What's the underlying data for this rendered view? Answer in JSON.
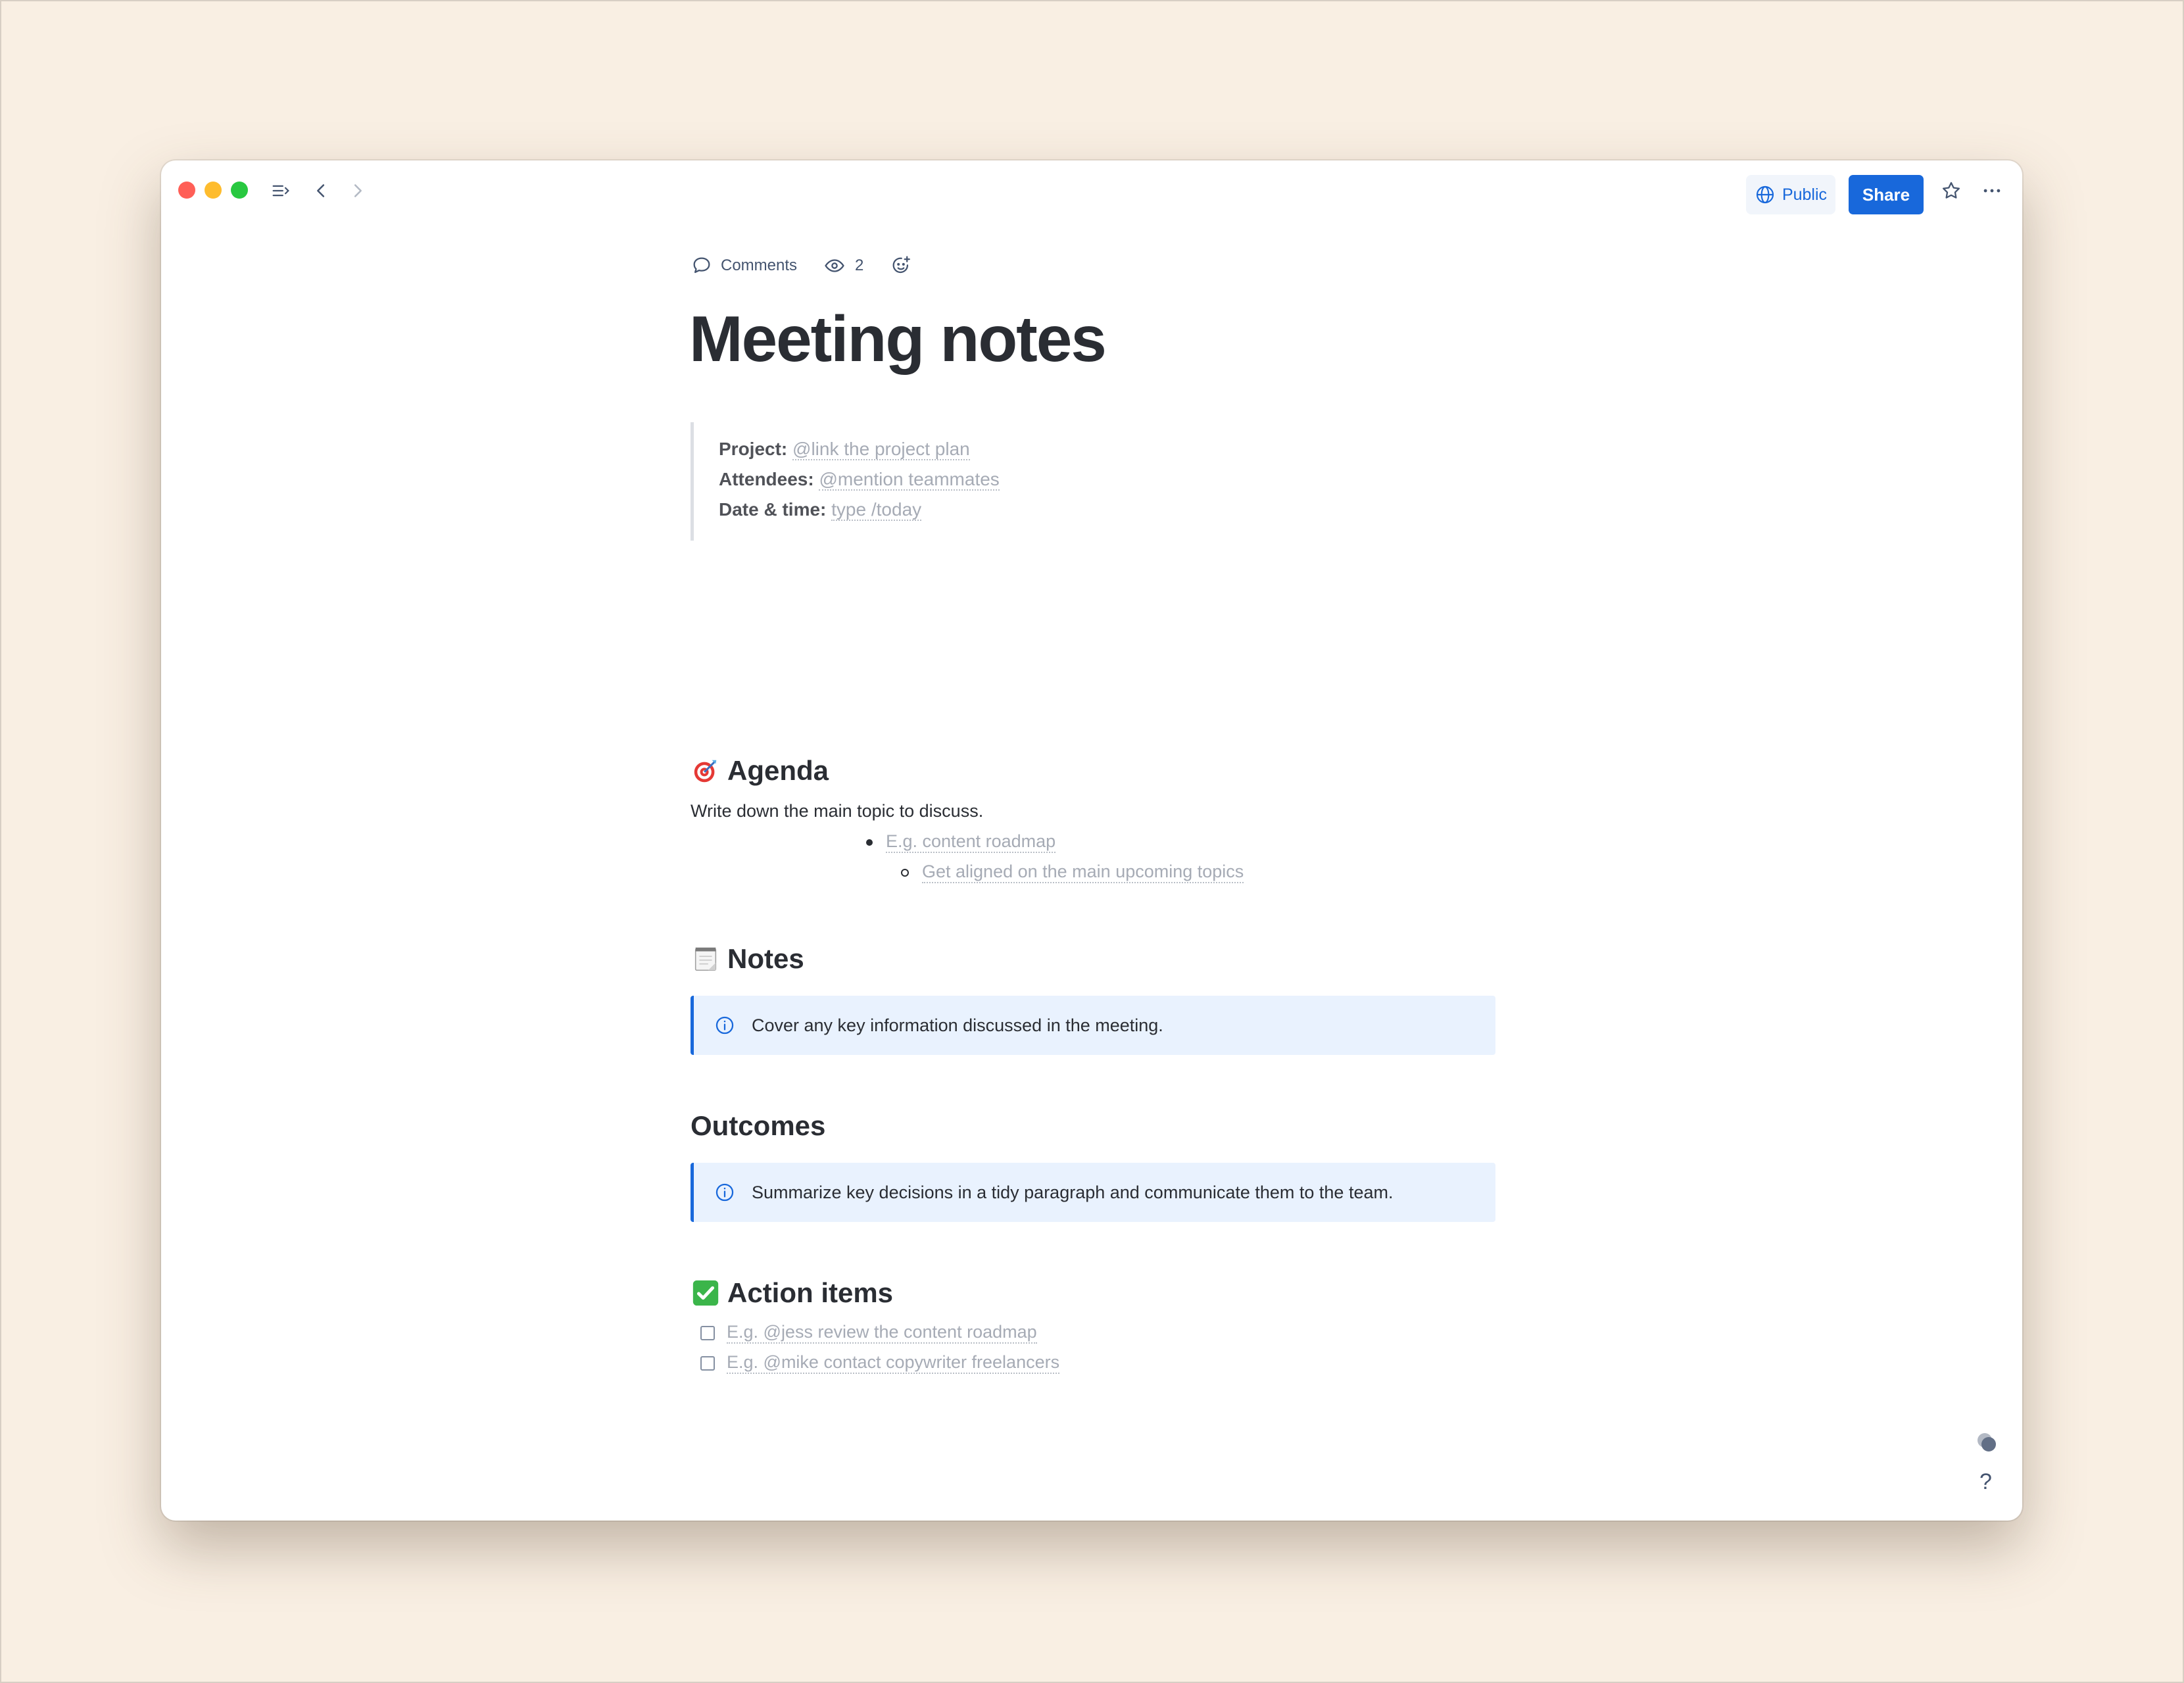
{
  "toolbar": {
    "public_label": "Public",
    "share_label": "Share"
  },
  "byline": {
    "comments_label": "Comments",
    "viewers_count": "2"
  },
  "page": {
    "title": "Meeting notes"
  },
  "details": [
    {
      "label": "Project:",
      "placeholder": "@link the project plan"
    },
    {
      "label": "Attendees:",
      "placeholder": "@mention teammates"
    },
    {
      "label": "Date & time:",
      "placeholder": "type /today"
    }
  ],
  "agenda": {
    "heading": "Agenda",
    "emoji": "direct-hit-icon",
    "intro": "Write down the main topic to discuss.",
    "bullet": "E.g. content roadmap",
    "sub_bullet": "Get aligned on the main upcoming topics"
  },
  "notes": {
    "heading": "Notes",
    "emoji": "notepad-icon",
    "panel_text": "Cover any key information discussed in the meeting."
  },
  "outcomes": {
    "heading": "Outcomes",
    "panel_text": "Summarize key decisions in a tidy paragraph and communicate them to the team."
  },
  "action_items": {
    "heading": "Action items",
    "emoji": "check-mark-button-icon",
    "tasks": [
      "E.g. @jess review the content roadmap",
      "E.g. @mike contact copywriter freelancers"
    ]
  },
  "help": {
    "label": "?"
  },
  "colors": {
    "accent": "#1868db",
    "panel_bg": "#e9f2fe",
    "page_bg": "#f9efe3"
  }
}
